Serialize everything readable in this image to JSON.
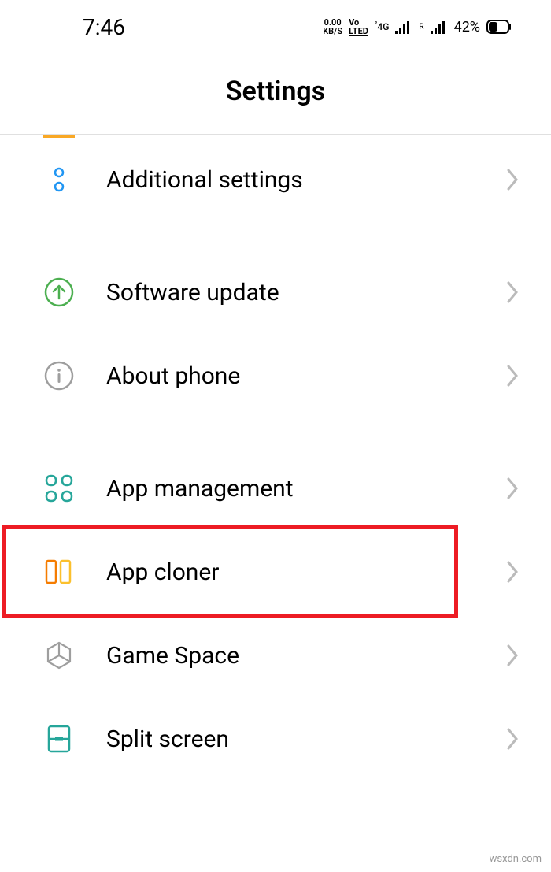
{
  "status": {
    "time": "7:46",
    "data_speed_top": "0.00",
    "data_speed_bottom": "KB/S",
    "volte": "Vo\nLTED",
    "network": "4G",
    "roaming": "R",
    "battery_pct": "42%"
  },
  "header": {
    "title": "Settings"
  },
  "items": {
    "additional": "Additional settings",
    "software_update": "Software update",
    "about_phone": "About phone",
    "app_management": "App management",
    "app_cloner": "App cloner",
    "game_space": "Game Space",
    "split_screen": "Split screen"
  },
  "watermark": "wsxdn.com"
}
